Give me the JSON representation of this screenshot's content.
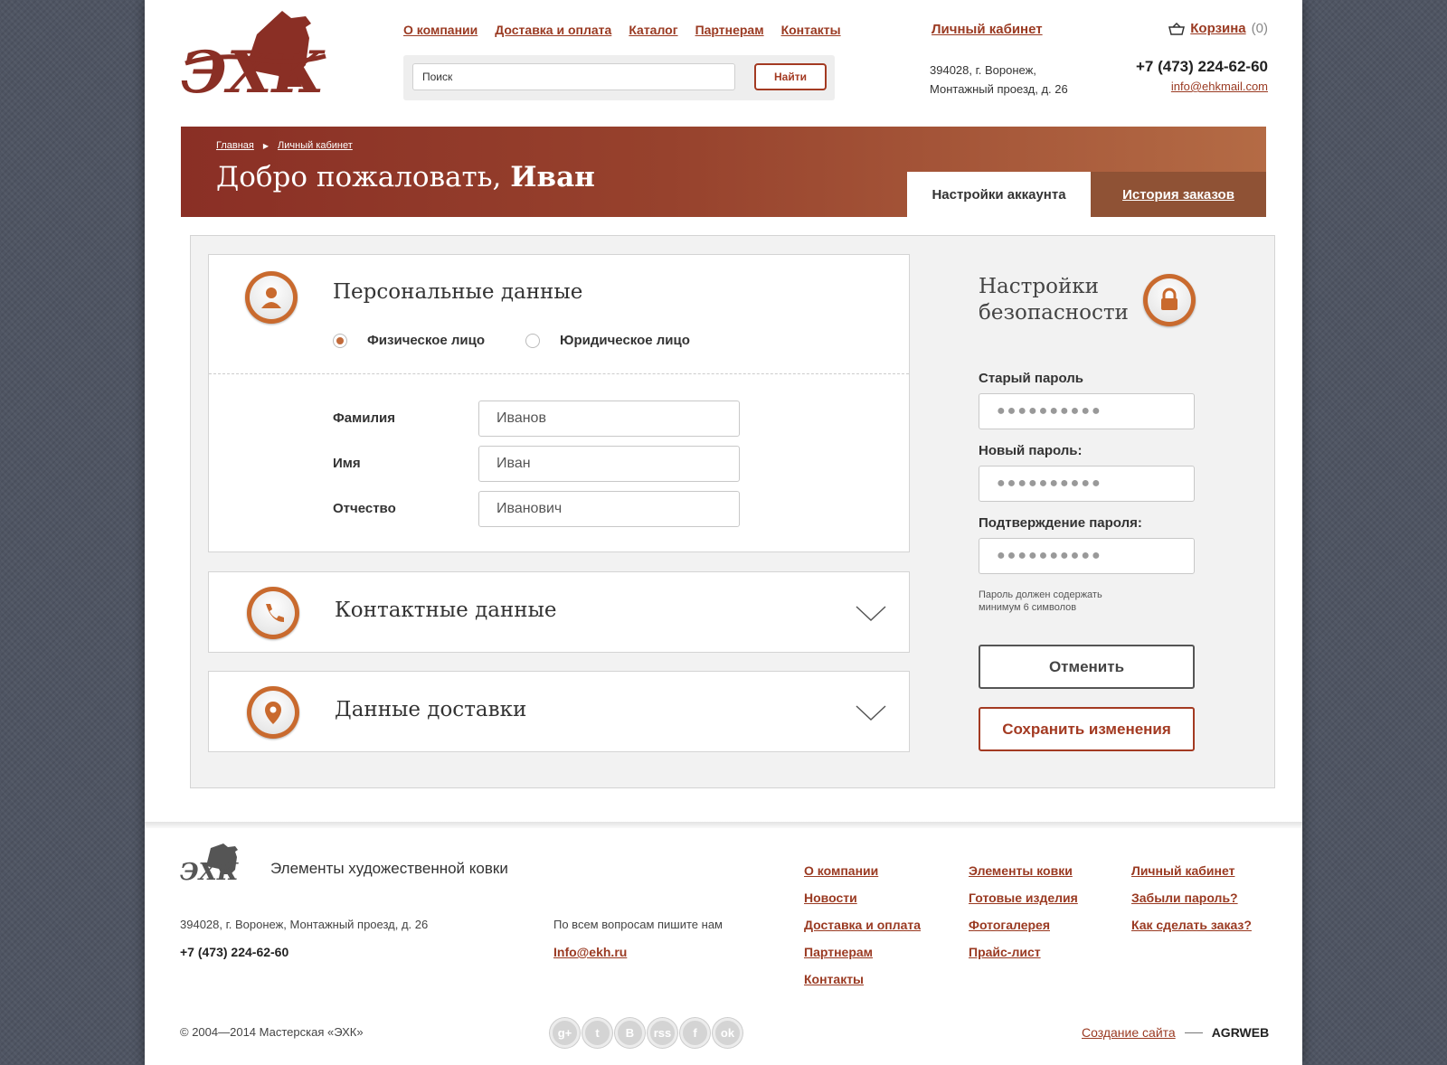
{
  "header": {
    "nav": [
      "О компании",
      "Доставка и оплата",
      "Каталог",
      "Партнерам",
      "Контакты"
    ],
    "search_placeholder": "Поиск",
    "search_button": "Найти",
    "cabinet": "Личный кабинет",
    "address_line1": "394028, г. Воронеж,",
    "address_line2": "Монтажный проезд, д. 26",
    "cart_label": "Корзина",
    "cart_count": "(0)",
    "phone": "+7 (473) 224-62-60",
    "email": "info@ehkmail.com"
  },
  "banner": {
    "crumb_home": "Главная",
    "crumb_current": "Личный кабинет",
    "welcome_prefix": "Добро пожаловать, ",
    "welcome_name": "Иван",
    "tab_settings": "Настройки аккаунта",
    "tab_history": "История заказов"
  },
  "personal": {
    "title": "Персональные данные",
    "radio_individual": "Физическое лицо",
    "radio_legal": "Юридическое лицо",
    "surname_label": "Фамилия",
    "surname_value": "Иванов",
    "name_label": "Имя",
    "name_value": "Иван",
    "patronymic_label": "Отчество",
    "patronymic_value": "Иванович"
  },
  "contacts": {
    "title": "Контактные данные"
  },
  "delivery": {
    "title": "Данные доставки"
  },
  "security": {
    "title_line1": "Настройки",
    "title_line2": "безопасности",
    "old_label": "Старый пароль",
    "new_label": "Новый пароль:",
    "confirm_label": "Подтверждение пароля:",
    "masked": "●●●●●●●●●●",
    "hint_line1": "Пароль должен содержать",
    "hint_line2": "минимум 6 символов",
    "cancel": "Отменить",
    "save": "Сохранить изменения"
  },
  "footer": {
    "tagline": "Элементы художественной ковки",
    "address": "394028, г. Воронеж, Монтажный проезд, д. 26",
    "phone": "+7 (473) 224-62-60",
    "question": "По всем вопросам пишите нам",
    "email": "Info@ekh.ru",
    "col1": [
      "О компании",
      "Новости",
      "Доставка и оплата",
      "Партнерам",
      "Контакты"
    ],
    "col2": [
      "Элементы ковки",
      "Готовые изделия",
      "Фотогалерея",
      "Прайс-лист"
    ],
    "col3": [
      "Личный кабинет",
      "Забыли пароль?",
      "Как сделать заказ?"
    ],
    "copyright": "© 2004—2014 Мастерская «ЭХК»",
    "social": [
      "g+",
      "t",
      "B",
      "rss",
      "f",
      "ok"
    ],
    "maker_link": "Создание сайта",
    "maker_name": "AGRWEB"
  },
  "colors": {
    "accent": "#9a3a22",
    "banner_start": "#8a2f25",
    "banner_end": "#b46b45",
    "icon_ring": "#c96a2e"
  }
}
